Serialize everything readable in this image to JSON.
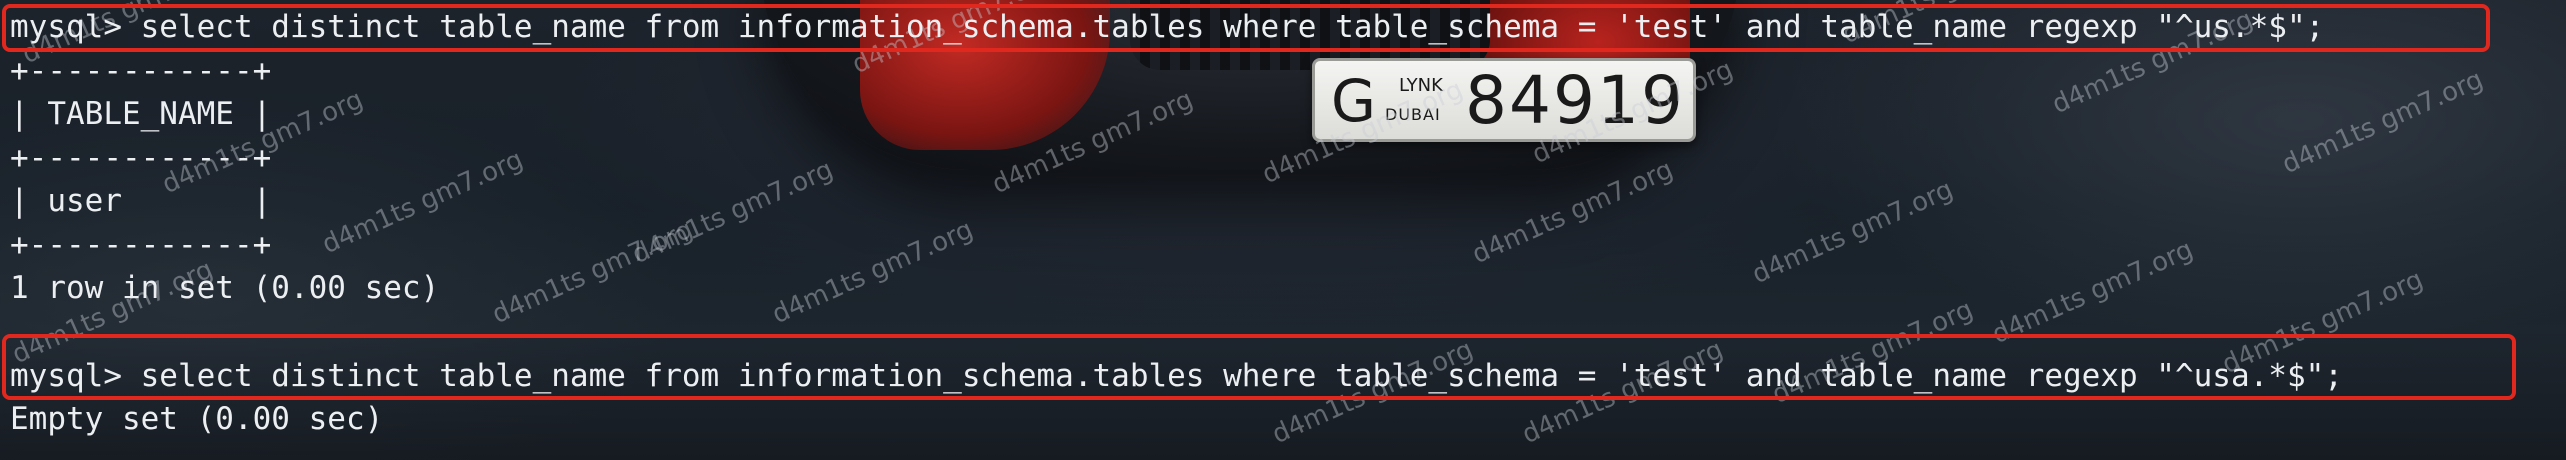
{
  "terminal": {
    "lines": [
      "mysql> select distinct table_name from information_schema.tables where table_schema = 'test' and table_name regexp \"^us.*$\";",
      "+------------+",
      "| TABLE_NAME |",
      "+------------+",
      "| user       |",
      "+------------+",
      "1 row in set (0.00 sec)",
      "",
      "mysql> select distinct table_name from information_schema.tables where table_schema = 'test' and table_name regexp \"^usa.*$\";",
      "Empty set (0.00 sec)"
    ]
  },
  "plate": {
    "letter": "G",
    "emblem": "LYNK",
    "city": "DUBAI",
    "number": "84919"
  },
  "watermark": {
    "text": "d4m1ts gm7.org"
  },
  "colors": {
    "highlight": "#e0281f",
    "text": "#eceff2"
  }
}
